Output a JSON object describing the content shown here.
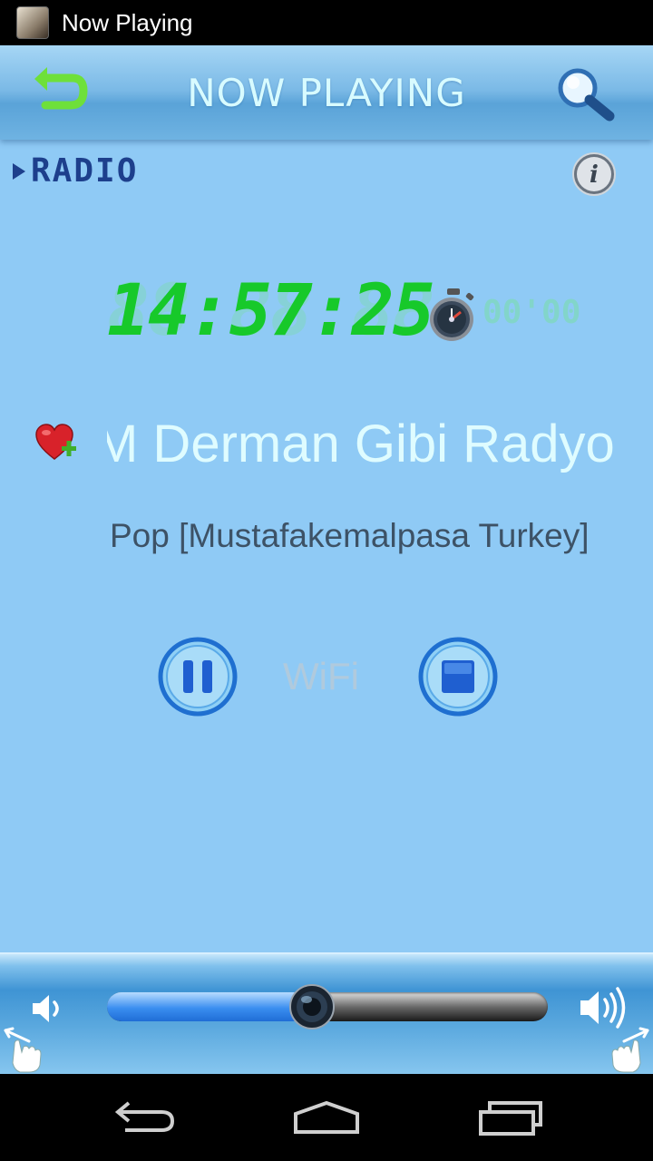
{
  "status_bar": {
    "title": "Now Playing"
  },
  "header": {
    "title": "NOW PLAYING",
    "back_icon": "back-arrow-icon",
    "search_icon": "search-icon"
  },
  "source": {
    "label": "RADIO",
    "info_icon": "info-icon"
  },
  "clock": {
    "background_digits": "88:88:88",
    "time": "14:57:25"
  },
  "sleep_timer": {
    "icon": "stopwatch-icon",
    "value": "00'00"
  },
  "station": {
    "favorite_icon": "heart-add-icon",
    "name": "M Derman Gibi Radyo",
    "genre": "Pop [Mustafakemalpasa Turkey]"
  },
  "controls": {
    "pause_icon": "pause-icon",
    "connection": "WiFi",
    "stop_icon": "stop-icon"
  },
  "volume": {
    "level": 0.465,
    "down_icon": "volume-down-icon",
    "up_icon": "volume-up-icon"
  },
  "colors": {
    "background": "#8fcaf5",
    "clock_green": "#17c92a",
    "header_text": "#d8fbff",
    "accent_blue": "#1f6dd6"
  },
  "navigation": {
    "back_icon": "nav-back-icon",
    "home_icon": "nav-home-icon",
    "recents_icon": "nav-recents-icon"
  }
}
